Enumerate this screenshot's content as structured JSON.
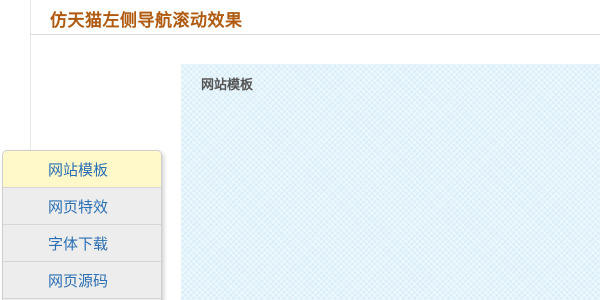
{
  "header": {
    "title": "仿天猫左侧导航滚动效果"
  },
  "content": {
    "section_title": "网站模板"
  },
  "sidenav": {
    "items": [
      {
        "label": "网站模板",
        "active": true
      },
      {
        "label": "网页特效",
        "active": false
      },
      {
        "label": "字体下载",
        "active": false
      },
      {
        "label": "网页源码",
        "active": false
      }
    ]
  },
  "colors": {
    "title": "#b05a10",
    "nav_text": "#2a6fb3",
    "nav_active_bg": "#fff9c9",
    "nav_bg": "#ededed",
    "panel_bg": "#e4f4fc"
  }
}
